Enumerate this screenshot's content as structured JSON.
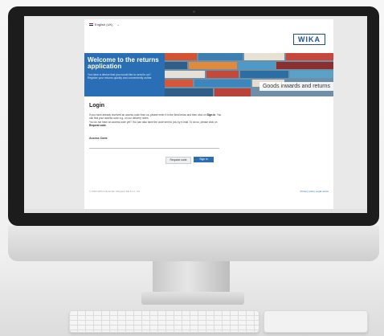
{
  "language": {
    "label": "English (UK)"
  },
  "brand": {
    "logo_text": "WIKA",
    "accent": "#2a6fb6",
    "logo_color": "#1d4f91"
  },
  "hero": {
    "title": "Welcome to the returns application",
    "subtitle": "You have a device that you would like to send to us? Register your returns quickly and conveniently online.",
    "image_caption": "Goods inwards and returns"
  },
  "login": {
    "title": "Login",
    "paragraph_1": "If you have already received an access code from us, please enter it in the field below and then click on",
    "paragraph_1_bold": "Sign in",
    "paragraph_1_end": ". You can find your access code e.g. on our delivery notes.",
    "paragraph_2": "You do not have an access code yet? You can also have the code sent to you by e-mail. To do so, please click on",
    "paragraph_2_bold": "Request code",
    "paragraph_2_end": ".",
    "field_label": "Access Code",
    "field_value": "",
    "request_button": "Request code",
    "signin_button": "Sign in"
  },
  "footer": {
    "copyright": "© 2023 WIKA Alexander Wiegand SE & Co. KG",
    "links": "Privacy policy  Legal notice"
  },
  "icons": {
    "language_flag": "uk-flag-icon",
    "language_dropdown": "chevron-down-icon"
  }
}
